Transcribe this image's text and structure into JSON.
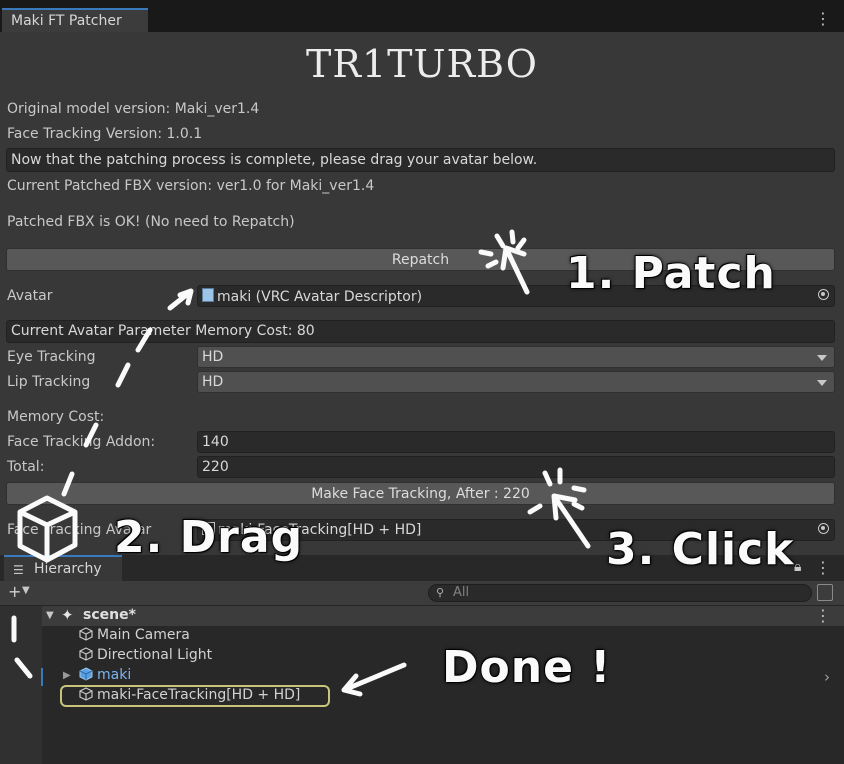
{
  "window": {
    "tab_title": "Maki FT Patcher",
    "brand": "TR1TURBO"
  },
  "info": {
    "original_model": "Original model version: Maki_ver1.4",
    "face_tracking_version": "Face Tracking Version: 1.0.1",
    "message": "Now that the patching process is complete, please drag your avatar below.",
    "patched_fbx_version": "Current Patched FBX version: ver1.0 for Maki_ver1.4",
    "patched_status": "Patched FBX is OK! (No need to Repatch)"
  },
  "repatch_button": "Repatch",
  "avatar": {
    "label": "Avatar",
    "value": "maki (VRC Avatar Descriptor)"
  },
  "memory_cost_box": "Current Avatar Parameter Memory Cost: 80",
  "eye_tracking": {
    "label": "Eye Tracking",
    "value": "HD"
  },
  "lip_tracking": {
    "label": "Lip Tracking",
    "value": "HD"
  },
  "memory": {
    "heading": "Memory Cost:",
    "addon_label": "Face Tracking Addon:",
    "addon_value": "140",
    "total_label": "Total:",
    "total_value": "220"
  },
  "make_button": "Make Face Tracking, After : 220",
  "face_tracking_avatar": {
    "label": "Face Tracking Avatar",
    "value": "maki-FaceTracking[HD + HD]"
  },
  "hierarchy": {
    "tab_label": "Hierarchy",
    "search_placeholder": "All",
    "scene": "scene*",
    "items": [
      "Main Camera",
      "Directional Light",
      "maki",
      "maki-FaceTracking[HD + HD]"
    ]
  },
  "annotations": {
    "patch": "1. Patch",
    "drag": "2. Drag",
    "click": "3. Click",
    "done": "Done !"
  }
}
